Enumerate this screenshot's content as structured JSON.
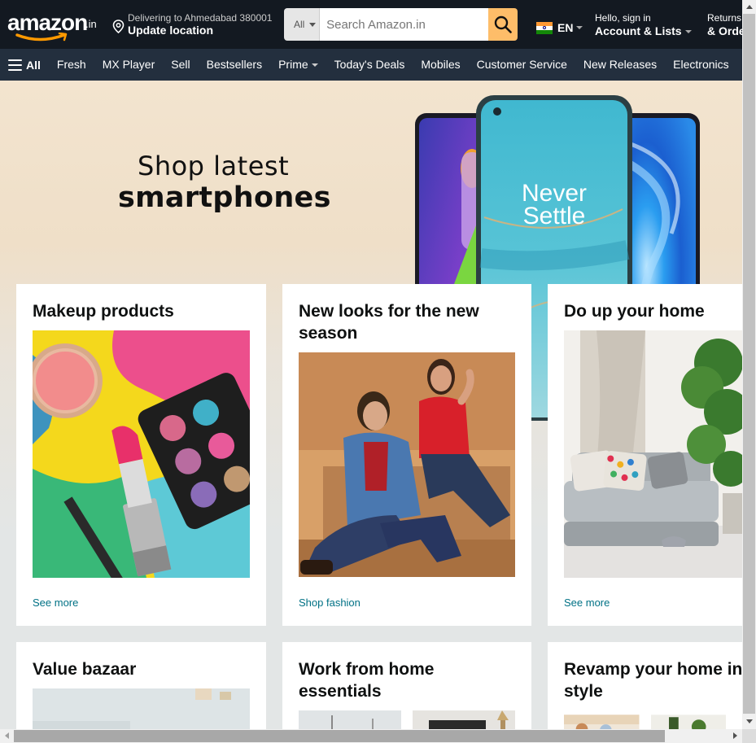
{
  "header": {
    "logo_text": "amazon",
    "logo_tld": ".in",
    "deliver_line1": "Delivering to Ahmedabad 380001",
    "deliver_line2": "Update location",
    "search_category": "All",
    "search_placeholder": "Search Amazon.in",
    "language": "EN",
    "account_line1": "Hello, sign in",
    "account_line2": "Account & Lists",
    "returns_line1": "Returns",
    "returns_line2": "& Orders"
  },
  "subnav": {
    "all_label": "All",
    "links": [
      "Fresh",
      "MX Player",
      "Sell",
      "Bestsellers",
      "Prime",
      "Today's Deals",
      "Mobiles",
      "Customer Service",
      "New Releases",
      "Electronics"
    ]
  },
  "hero": {
    "line1": "Shop latest",
    "line2": "smartphones",
    "phone_text_1": "Never",
    "phone_text_2": "Settle"
  },
  "cards": [
    {
      "title": "Makeup products",
      "link": "See more"
    },
    {
      "title": "New looks for the new season",
      "link": "Shop fashion"
    },
    {
      "title": "Do up your home",
      "link": "See more"
    },
    {
      "title": "Value bazaar"
    },
    {
      "title": "Work from home essentials"
    },
    {
      "title": "Revamp your home in style"
    }
  ],
  "colors": {
    "nav_bg": "#131921",
    "subnav_bg": "#232f3e",
    "search_button": "#febd69",
    "link": "#007185",
    "logo_smile": "#ff9900"
  }
}
